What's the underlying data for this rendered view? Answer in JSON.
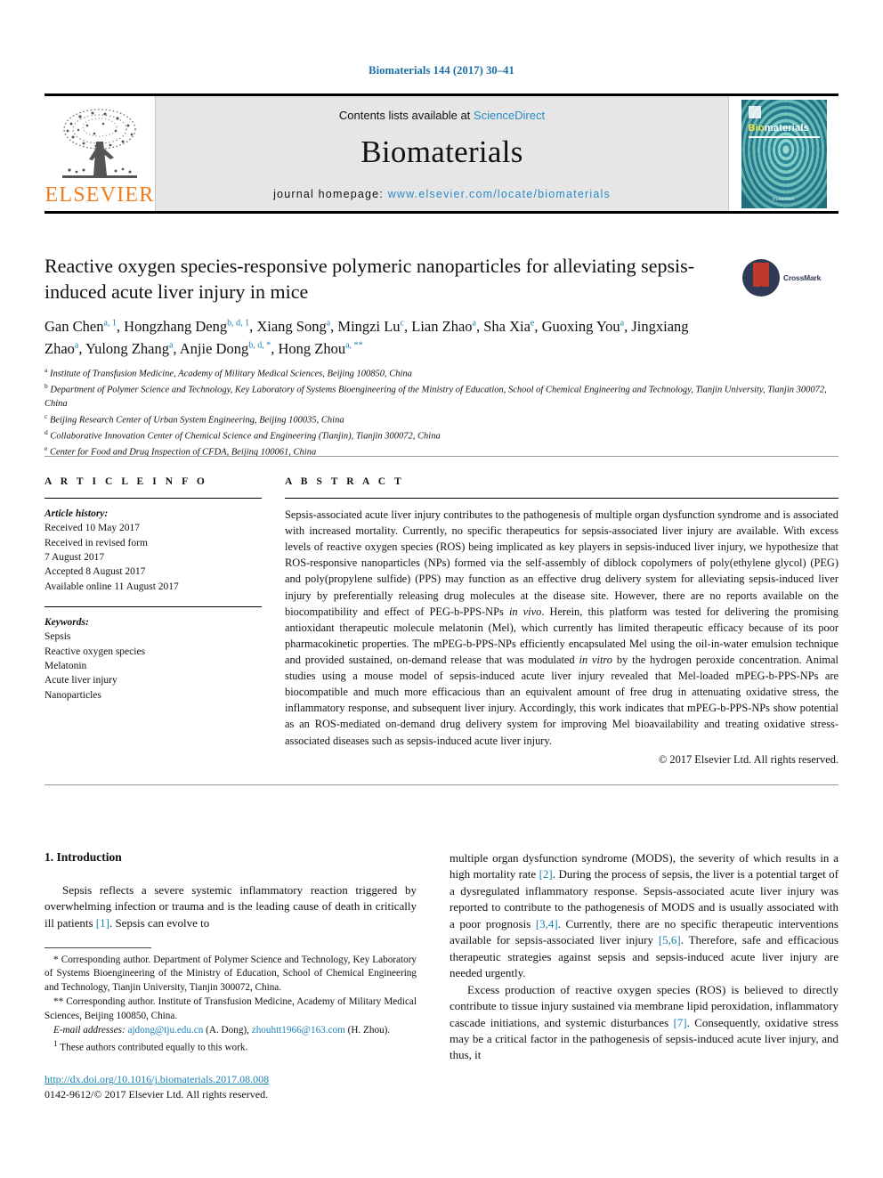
{
  "running_head": "Biomaterials 144 (2017) 30–41",
  "masthead": {
    "publisher_name": "ELSEVIER",
    "contents_prefix": "Contents lists available at ",
    "contents_link": "ScienceDirect",
    "journal_title": "Biomaterials",
    "homepage_prefix": "journal homepage: ",
    "homepage_url": "www.elsevier.com/locate/biomaterials",
    "cover_title_bio": "Bio",
    "cover_title_rest": "materials",
    "cover_footer": "ELSEVIER"
  },
  "article": {
    "title": "Reactive oxygen species-responsive polymeric nanoparticles for alleviating sepsis-induced acute liver injury in mice",
    "crossmark_label": "CrossMark"
  },
  "authors": [
    {
      "name": "Gan Chen",
      "sup": "a, 1"
    },
    {
      "name": "Hongzhang Deng",
      "sup": "b, d, 1"
    },
    {
      "name": "Xiang Song",
      "sup": "a"
    },
    {
      "name": "Mingzi Lu",
      "sup": "c"
    },
    {
      "name": "Lian Zhao",
      "sup": "a"
    },
    {
      "name": "Sha Xia",
      "sup": "e"
    },
    {
      "name": "Guoxing You",
      "sup": "a"
    },
    {
      "name": "Jingxiang Zhao",
      "sup": "a"
    },
    {
      "name": "Yulong Zhang",
      "sup": "a"
    },
    {
      "name": "Anjie Dong",
      "sup": "b, d, *"
    },
    {
      "name": "Hong Zhou",
      "sup": "a, **"
    }
  ],
  "affiliations": [
    {
      "key": "a",
      "text": "Institute of Transfusion Medicine, Academy of Military Medical Sciences, Beijing 100850, China"
    },
    {
      "key": "b",
      "text": "Department of Polymer Science and Technology, Key Laboratory of Systems Bioengineering of the Ministry of Education, School of Chemical Engineering and Technology, Tianjin University, Tianjin 300072, China"
    },
    {
      "key": "c",
      "text": "Beijing Research Center of Urban System Engineering, Beijing 100035, China"
    },
    {
      "key": "d",
      "text": "Collaborative Innovation Center of Chemical Science and Engineering (Tianjin), Tianjin 300072, China"
    },
    {
      "key": "e",
      "text": "Center for Food and Drug Inspection of CFDA, Beijing 100061, China"
    }
  ],
  "article_info": {
    "heading": "A R T I C L E  I N F O",
    "history_label": "Article history:",
    "history_lines": [
      "Received 10 May 2017",
      "Received in revised form",
      "7 August 2017",
      "Accepted 8 August 2017",
      "Available online 11 August 2017"
    ],
    "keywords_label": "Keywords:",
    "keywords": [
      "Sepsis",
      "Reactive oxygen species",
      "Melatonin",
      "Acute liver injury",
      "Nanoparticles"
    ]
  },
  "abstract": {
    "heading": "A B S T R A C T",
    "part1": "Sepsis-associated acute liver injury contributes to the pathogenesis of multiple organ dysfunction syndrome and is associated with increased mortality. Currently, no specific therapeutics for sepsis-associated liver injury are available. With excess levels of reactive oxygen species (ROS) being implicated as key players in sepsis-induced liver injury, we hypothesize that ROS-responsive nanoparticles (NPs) formed via the self-assembly of diblock copolymers of poly(ethylene glycol) (PEG) and poly(propylene sulfide) (PPS) may function as an effective drug delivery system for alleviating sepsis-induced liver injury by preferentially releasing drug molecules at the disease site. However, there are no reports available on the biocompatibility and effect of PEG-b-PPS-NPs ",
    "italic1": "in vivo",
    "part2": ". Herein, this platform was tested for delivering the promising antioxidant therapeutic molecule melatonin (Mel), which currently has limited therapeutic efficacy because of its poor pharmacokinetic properties. The mPEG-b-PPS-NPs efficiently encapsulated Mel using the oil-in-water emulsion technique and provided sustained, on-demand release that was modulated ",
    "italic2": "in vitro",
    "part3": " by the hydrogen peroxide concentration. Animal studies using a mouse model of sepsis-induced acute liver injury revealed that Mel-loaded mPEG-b-PPS-NPs are biocompatible and much more efficacious than an equivalent amount of free drug in attenuating oxidative stress, the inflammatory response, and subsequent liver injury. Accordingly, this work indicates that mPEG-b-PPS-NPs show potential as an ROS-mediated on-demand drug delivery system for improving Mel bioavailability and treating oxidative stress-associated diseases such as sepsis-induced acute liver injury.",
    "copyright": "© 2017 Elsevier Ltd. All rights reserved."
  },
  "body": {
    "section_heading": "1. Introduction",
    "left_p1_a": "Sepsis reflects a severe systemic inflammatory reaction triggered by overwhelming infection or trauma and is the leading cause of death in critically ill patients ",
    "left_p1_ref": "[1]",
    "left_p1_b": ". Sepsis can evolve to",
    "right_p1_a": "multiple organ dysfunction syndrome (MODS), the severity of which results in a high mortality rate ",
    "right_p1_ref1": "[2]",
    "right_p1_b": ". During the process of sepsis, the liver is a potential target of a dysregulated inflammatory response. Sepsis-associated acute liver injury was reported to contribute to the pathogenesis of MODS and is usually associated with a poor prognosis ",
    "right_p1_ref2": "[3,4]",
    "right_p1_c": ". Currently, there are no specific therapeutic interventions available for sepsis-associated liver injury ",
    "right_p1_ref3": "[5,6]",
    "right_p1_d": ". Therefore, safe and efficacious therapeutic strategies against sepsis and sepsis-induced acute liver injury are needed urgently.",
    "right_p2_a": "Excess production of reactive oxygen species (ROS) is believed to directly contribute to tissue injury sustained via membrane lipid peroxidation, inflammatory cascade initiations, and systemic disturbances ",
    "right_p2_ref": "[7]",
    "right_p2_b": ". Consequently, oxidative stress may be a critical factor in the pathogenesis of sepsis-induced acute liver injury, and thus, it"
  },
  "footnotes": {
    "corr1_marker": "*",
    "corr1": "Corresponding author. Department of Polymer Science and Technology, Key Laboratory of Systems Bioengineering of the Ministry of Education, School of Chemical Engineering and Technology, Tianjin University, Tianjin 300072, China.",
    "corr2_marker": "**",
    "corr2": "Corresponding author. Institute of Transfusion Medicine, Academy of Military Medical Sciences, Beijing 100850, China.",
    "email_label": "E-mail addresses:",
    "email1": "ajdong@tju.edu.cn",
    "email1_owner": "(A. Dong),",
    "email2": "zhouhtt1966@163.com",
    "email2_owner": "(H. Zhou).",
    "equal_marker": "1",
    "equal_contrib": "These authors contributed equally to this work."
  },
  "doi": {
    "url": "http://dx.doi.org/10.1016/j.biomaterials.2017.08.008",
    "issn_line": "0142-9612/© 2017 Elsevier Ltd. All rights reserved."
  }
}
